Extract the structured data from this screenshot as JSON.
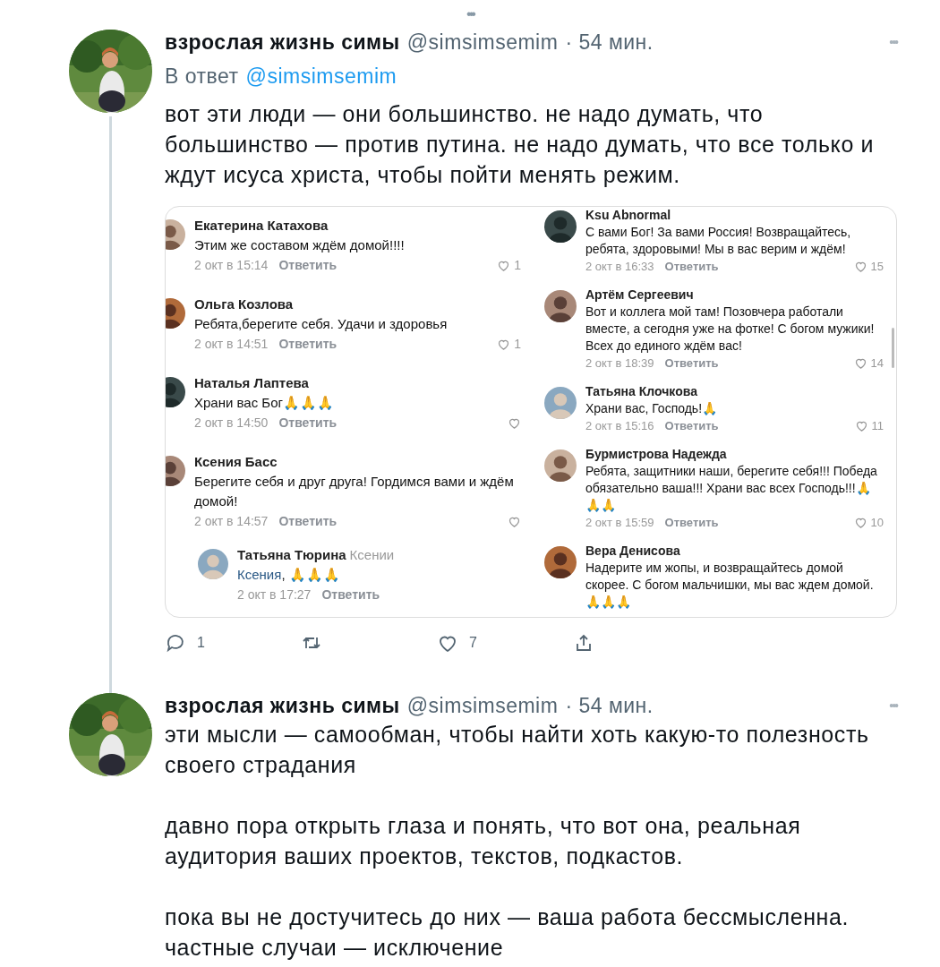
{
  "more_indicator": "•••",
  "tweets": [
    {
      "author": "взрослая жизнь симы",
      "handle": "@simsimsemim",
      "time": "· 54 мин.",
      "reply_prefix": "В ответ",
      "reply_to": "@simsimsemim",
      "paragraphs": [
        "вот эти люди — они большинство. не надо думать, что большинство — против путина. не надо думать, что все только и ждут исуса христа, чтобы пойти менять режим."
      ],
      "thread_line": true,
      "embed": {
        "columns": [
          [
            {
              "name": "Екатерина Катахова",
              "text": "Этим же составом ждём домой!!!!",
              "date": "2 окт в 15:14",
              "reply": "Ответить",
              "likes": "1"
            },
            {
              "name": "Ольга Козлова",
              "text": "Ребята,берегите себя. Удачи и здоровья",
              "date": "2 окт в 14:51",
              "reply": "Ответить",
              "likes": "1"
            },
            {
              "name": "Наталья Лаптева",
              "text": "Храни вас Бог🙏🙏🙏",
              "date": "2 окт в 14:50",
              "reply": "Ответить"
            },
            {
              "name": "Ксения Басс",
              "text": "Берегите себя и друг друга! Гордимся вами и ждём домой!",
              "date": "2 окт в 14:57",
              "reply": "Ответить",
              "replies": [
                {
                  "name": "Татьяна Тюрина",
                  "to": "Ксении",
                  "mention": "Ксения",
                  "text": ", 🙏🙏🙏",
                  "date": "2 окт в 17:27",
                  "reply": "Ответить"
                }
              ]
            }
          ],
          [
            {
              "name": "Ksu Abnormal",
              "text": "С вами Бог! За вами Россия! Возвращайтесь, ребята, здоровыми! Мы в вас верим и ждём!",
              "date": "2 окт в 16:33",
              "reply": "Ответить",
              "likes": "15"
            },
            {
              "name": "Артём Сергеевич",
              "text": "Вот и коллега мой там! Позовчера работали вместе, а сегодня уже на фотке! С богом мужики! Всех до единого ждём вас!",
              "date": "2 окт в 18:39",
              "reply": "Ответить",
              "likes": "14"
            },
            {
              "name": "Татьяна Клочкова",
              "text": "Храни вас, Господь!🙏",
              "date": "2 окт в 15:16",
              "reply": "Ответить",
              "likes": "11"
            },
            {
              "name": "Бурмистрова Надежда",
              "text": "Ребята, защитники наши, берегите себя!!! Победа обязательно ваша!!! Храни вас всех Господь!!!🙏🙏🙏",
              "date": "2 окт в 15:59",
              "reply": "Ответить",
              "likes": "10"
            },
            {
              "name": "Вера Денисова",
              "text": "Надерите им жопы, и возвращайтесь домой скорее. С богом мальчишки, мы вас ждем домой. 🙏🙏🙏"
            }
          ]
        ]
      },
      "actions": [
        {
          "kind": "reply",
          "count": "1"
        },
        {
          "kind": "retweet"
        },
        {
          "kind": "like",
          "count": "7"
        },
        {
          "kind": "share"
        }
      ]
    },
    {
      "author": "взрослая жизнь симы",
      "handle": "@simsimsemim",
      "time": "· 54 мин.",
      "paragraphs": [
        "эти мысли — самообман, чтобы найти хоть какую-то полезность своего страдания",
        "давно пора открыть глаза и понять, что вот она, реальная аудитория ваших проектов, текстов, подкастов.",
        "пока вы не достучитесь до них — ваша работа бессмысленна. частные случаи — исключение"
      ]
    }
  ]
}
